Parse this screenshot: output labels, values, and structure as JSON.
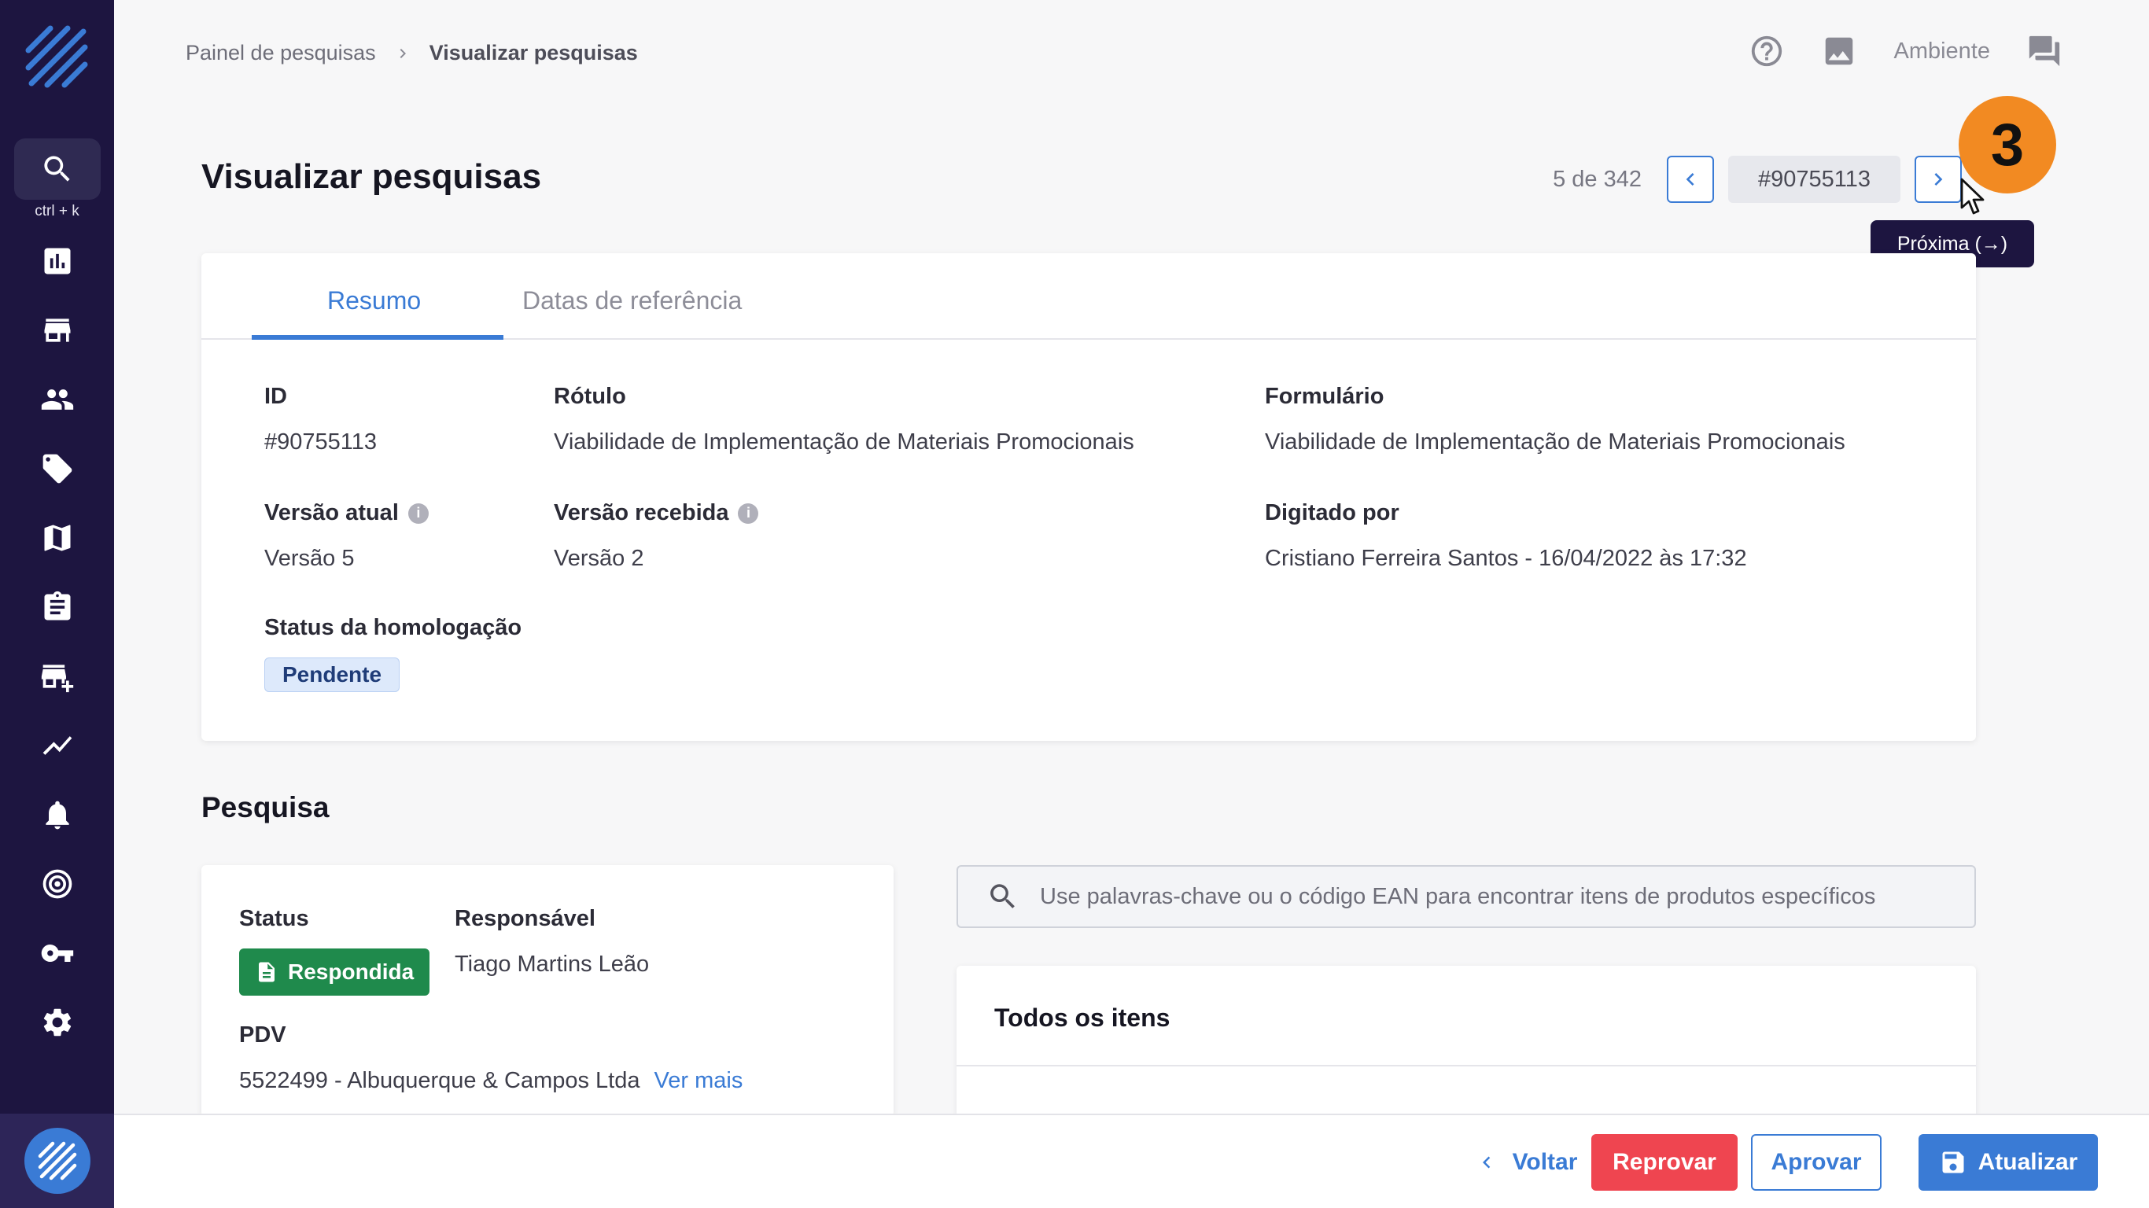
{
  "sidebar": {
    "shortcut": "ctrl + k",
    "icons": [
      "search-icon",
      "dashboard-icon",
      "store-icon",
      "people-icon",
      "tag-icon",
      "map-icon",
      "clipboard-icon",
      "add-business-icon",
      "trend-icon",
      "bell-icon",
      "target-icon",
      "key-icon",
      "gear-icon"
    ]
  },
  "breadcrumb": {
    "parent": "Painel de pesquisas",
    "current": "Visualizar pesquisas"
  },
  "topbar": {
    "env_label": "Ambiente"
  },
  "header": {
    "title": "Visualizar pesquisas",
    "counter": "5 de 342",
    "record_id": "#90755113",
    "tooltip": "Próxima (→)",
    "step_badge": "3"
  },
  "summary": {
    "tabs": [
      "Resumo",
      "Datas de referência"
    ],
    "fields": {
      "id_label": "ID",
      "id_value": "#90755113",
      "rotulo_label": "Rótulo",
      "rotulo_value": "Viabilidade de Implementação de Materiais Promocionais",
      "form_label": "Formulário",
      "form_value": "Viabilidade de Implementação de Materiais Promocionais",
      "versao_atual_label": "Versão atual",
      "versao_atual_value": "Versão 5",
      "versao_recebida_label": "Versão recebida",
      "versao_recebida_value": "Versão 2",
      "digitado_label": "Digitado por",
      "digitado_value": "Cristiano Ferreira Santos - 16/04/2022 às 17:32",
      "status_label": "Status da homologação",
      "status_value": "Pendente"
    }
  },
  "pesquisa": {
    "title": "Pesquisa",
    "status_label": "Status",
    "status_value": "Respondida",
    "responsavel_label": "Responsável",
    "responsavel_value": "Tiago Martins Leão",
    "pdv_label": "PDV",
    "pdv_value": "5522499 - Albuquerque & Campos Ltda",
    "ver_mais": "Ver mais",
    "search_placeholder": "Use palavras-chave ou o código EAN para encontrar itens de produtos específicos",
    "items_title": "Todos os itens"
  },
  "footer": {
    "back": "Voltar",
    "reject": "Reprovar",
    "approve": "Aprovar",
    "update": "Atualizar"
  },
  "colors": {
    "accent": "#3a7bd5",
    "sidebar": "#1d1540",
    "danger": "#ef4550",
    "success": "#1f8a4c",
    "highlight": "#f28a22"
  }
}
